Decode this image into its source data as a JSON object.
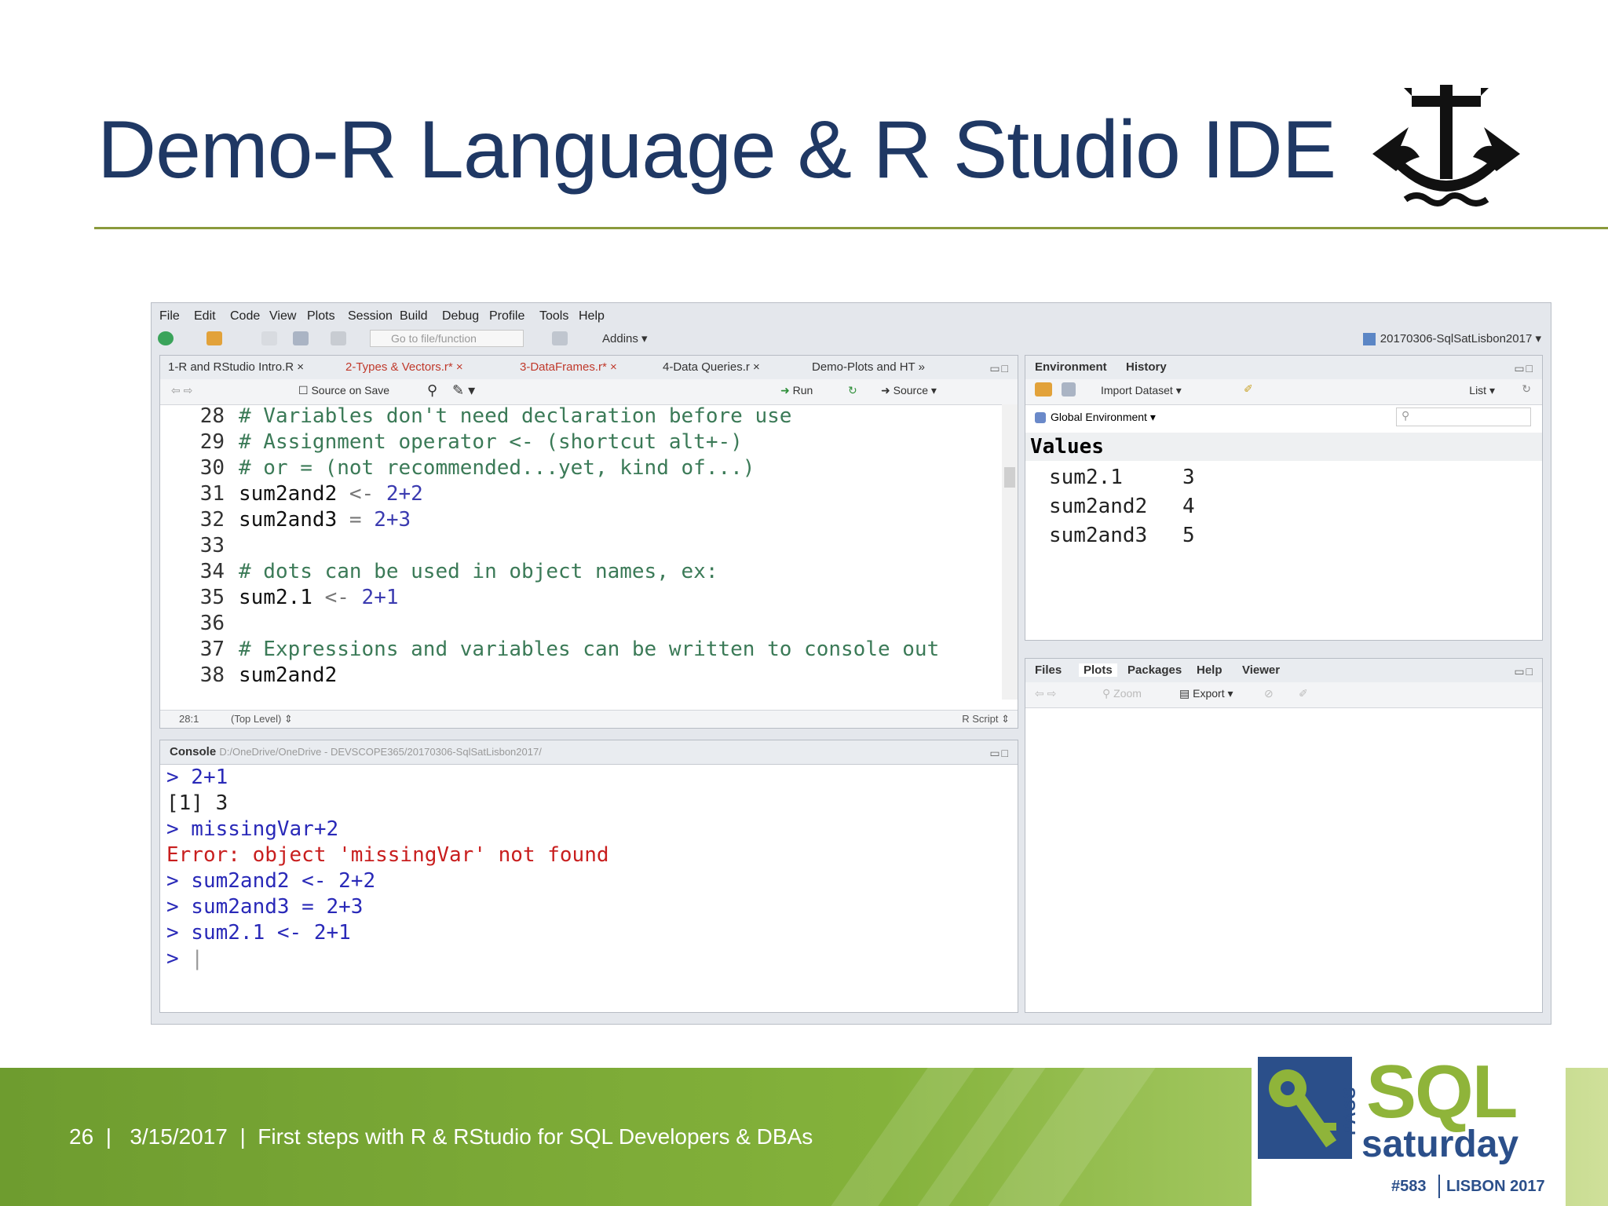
{
  "slide": {
    "title": "Demo-R Language & R Studio IDE",
    "footer_text": "26  |   3/15/2017  |  First steps with R & RStudio for SQL Developers & DBAs"
  },
  "rstudio": {
    "menu": [
      "File",
      "Edit",
      "Code",
      "View",
      "Plots",
      "Session",
      "Build",
      "Debug",
      "Profile",
      "Tools",
      "Help"
    ],
    "toolbar": {
      "goto_placeholder": "Go to file/function",
      "addins": "Addins",
      "project": "20170306-SqlSatLisbon2017"
    },
    "editor": {
      "tabs": [
        "1-R and RStudio Intro.R",
        "2-Types & Vectors.r*",
        "3-DataFrames.r*",
        "4-Data Queries.r",
        "Demo-Plots and HT"
      ],
      "source_on_save": "Source on Save",
      "run": "Run",
      "source": "Source",
      "lines": [
        {
          "n": "28",
          "comment": "# Variables don't need declaration before use"
        },
        {
          "n": "29",
          "comment": "# Assignment operator <- (shortcut alt+-)"
        },
        {
          "n": "30",
          "comment": "# or = (not recommended...yet, kind of...)"
        },
        {
          "n": "31",
          "id": "sum2and2",
          "op": "<-",
          "num": "2+2"
        },
        {
          "n": "32",
          "id": "sum2and3",
          "op": "=",
          "num": "2+3"
        },
        {
          "n": "33"
        },
        {
          "n": "34",
          "comment": "# dots can be used in object names, ex:"
        },
        {
          "n": "35",
          "id": "sum2.1",
          "op": "<-",
          "num": "2+1"
        },
        {
          "n": "36"
        },
        {
          "n": "37",
          "comment": "# Expressions and variables can be written to console out"
        },
        {
          "n": "38",
          "id": "sum2and2"
        }
      ],
      "cursor_pos": "28:1",
      "scope": "(Top Level)",
      "file_type": "R Script"
    },
    "console": {
      "label": "Console",
      "path": "D:/OneDrive/OneDrive - DEVSCOPE365/20170306-SqlSatLisbon2017/",
      "lines": [
        {
          "text": "> 2+1",
          "kind": "blue"
        },
        {
          "text": "[1] 3",
          "kind": "blk"
        },
        {
          "text": "> missingVar+2",
          "kind": "blue"
        },
        {
          "text": "Error: object 'missingVar' not found",
          "kind": "err"
        },
        {
          "text": "> sum2and2 <- 2+2",
          "kind": "blue"
        },
        {
          "text": "> sum2and3 = 2+3",
          "kind": "blue"
        },
        {
          "text": "> sum2.1 <- 2+1",
          "kind": "blue"
        },
        {
          "text": "> ",
          "kind": "blue"
        }
      ]
    },
    "environment": {
      "tabs": [
        "Environment",
        "History"
      ],
      "import_dataset": "Import Dataset",
      "list": "List",
      "scope": "Global Environment",
      "values_header": "Values",
      "values": [
        {
          "name": "sum2.1",
          "value": "3"
        },
        {
          "name": "sum2and2",
          "value": "4"
        },
        {
          "name": "sum2and3",
          "value": "5"
        }
      ]
    },
    "files": {
      "tabs": [
        "Files",
        "Plots",
        "Packages",
        "Help",
        "Viewer"
      ],
      "zoom": "Zoom",
      "export": "Export"
    }
  },
  "sql_logo": {
    "pass": "PASS",
    "sql": "SQL",
    "saturday": "saturday",
    "event": "#583",
    "city": "LISBON 2017"
  },
  "colors": {
    "title": "#1f3864",
    "rule": "#8a9a3c",
    "footer_green": "#7aa834",
    "comment": "#3b7a57",
    "number": "#3b3bb0",
    "console_blue": "#2929b8",
    "console_error": "#c81e1e"
  }
}
